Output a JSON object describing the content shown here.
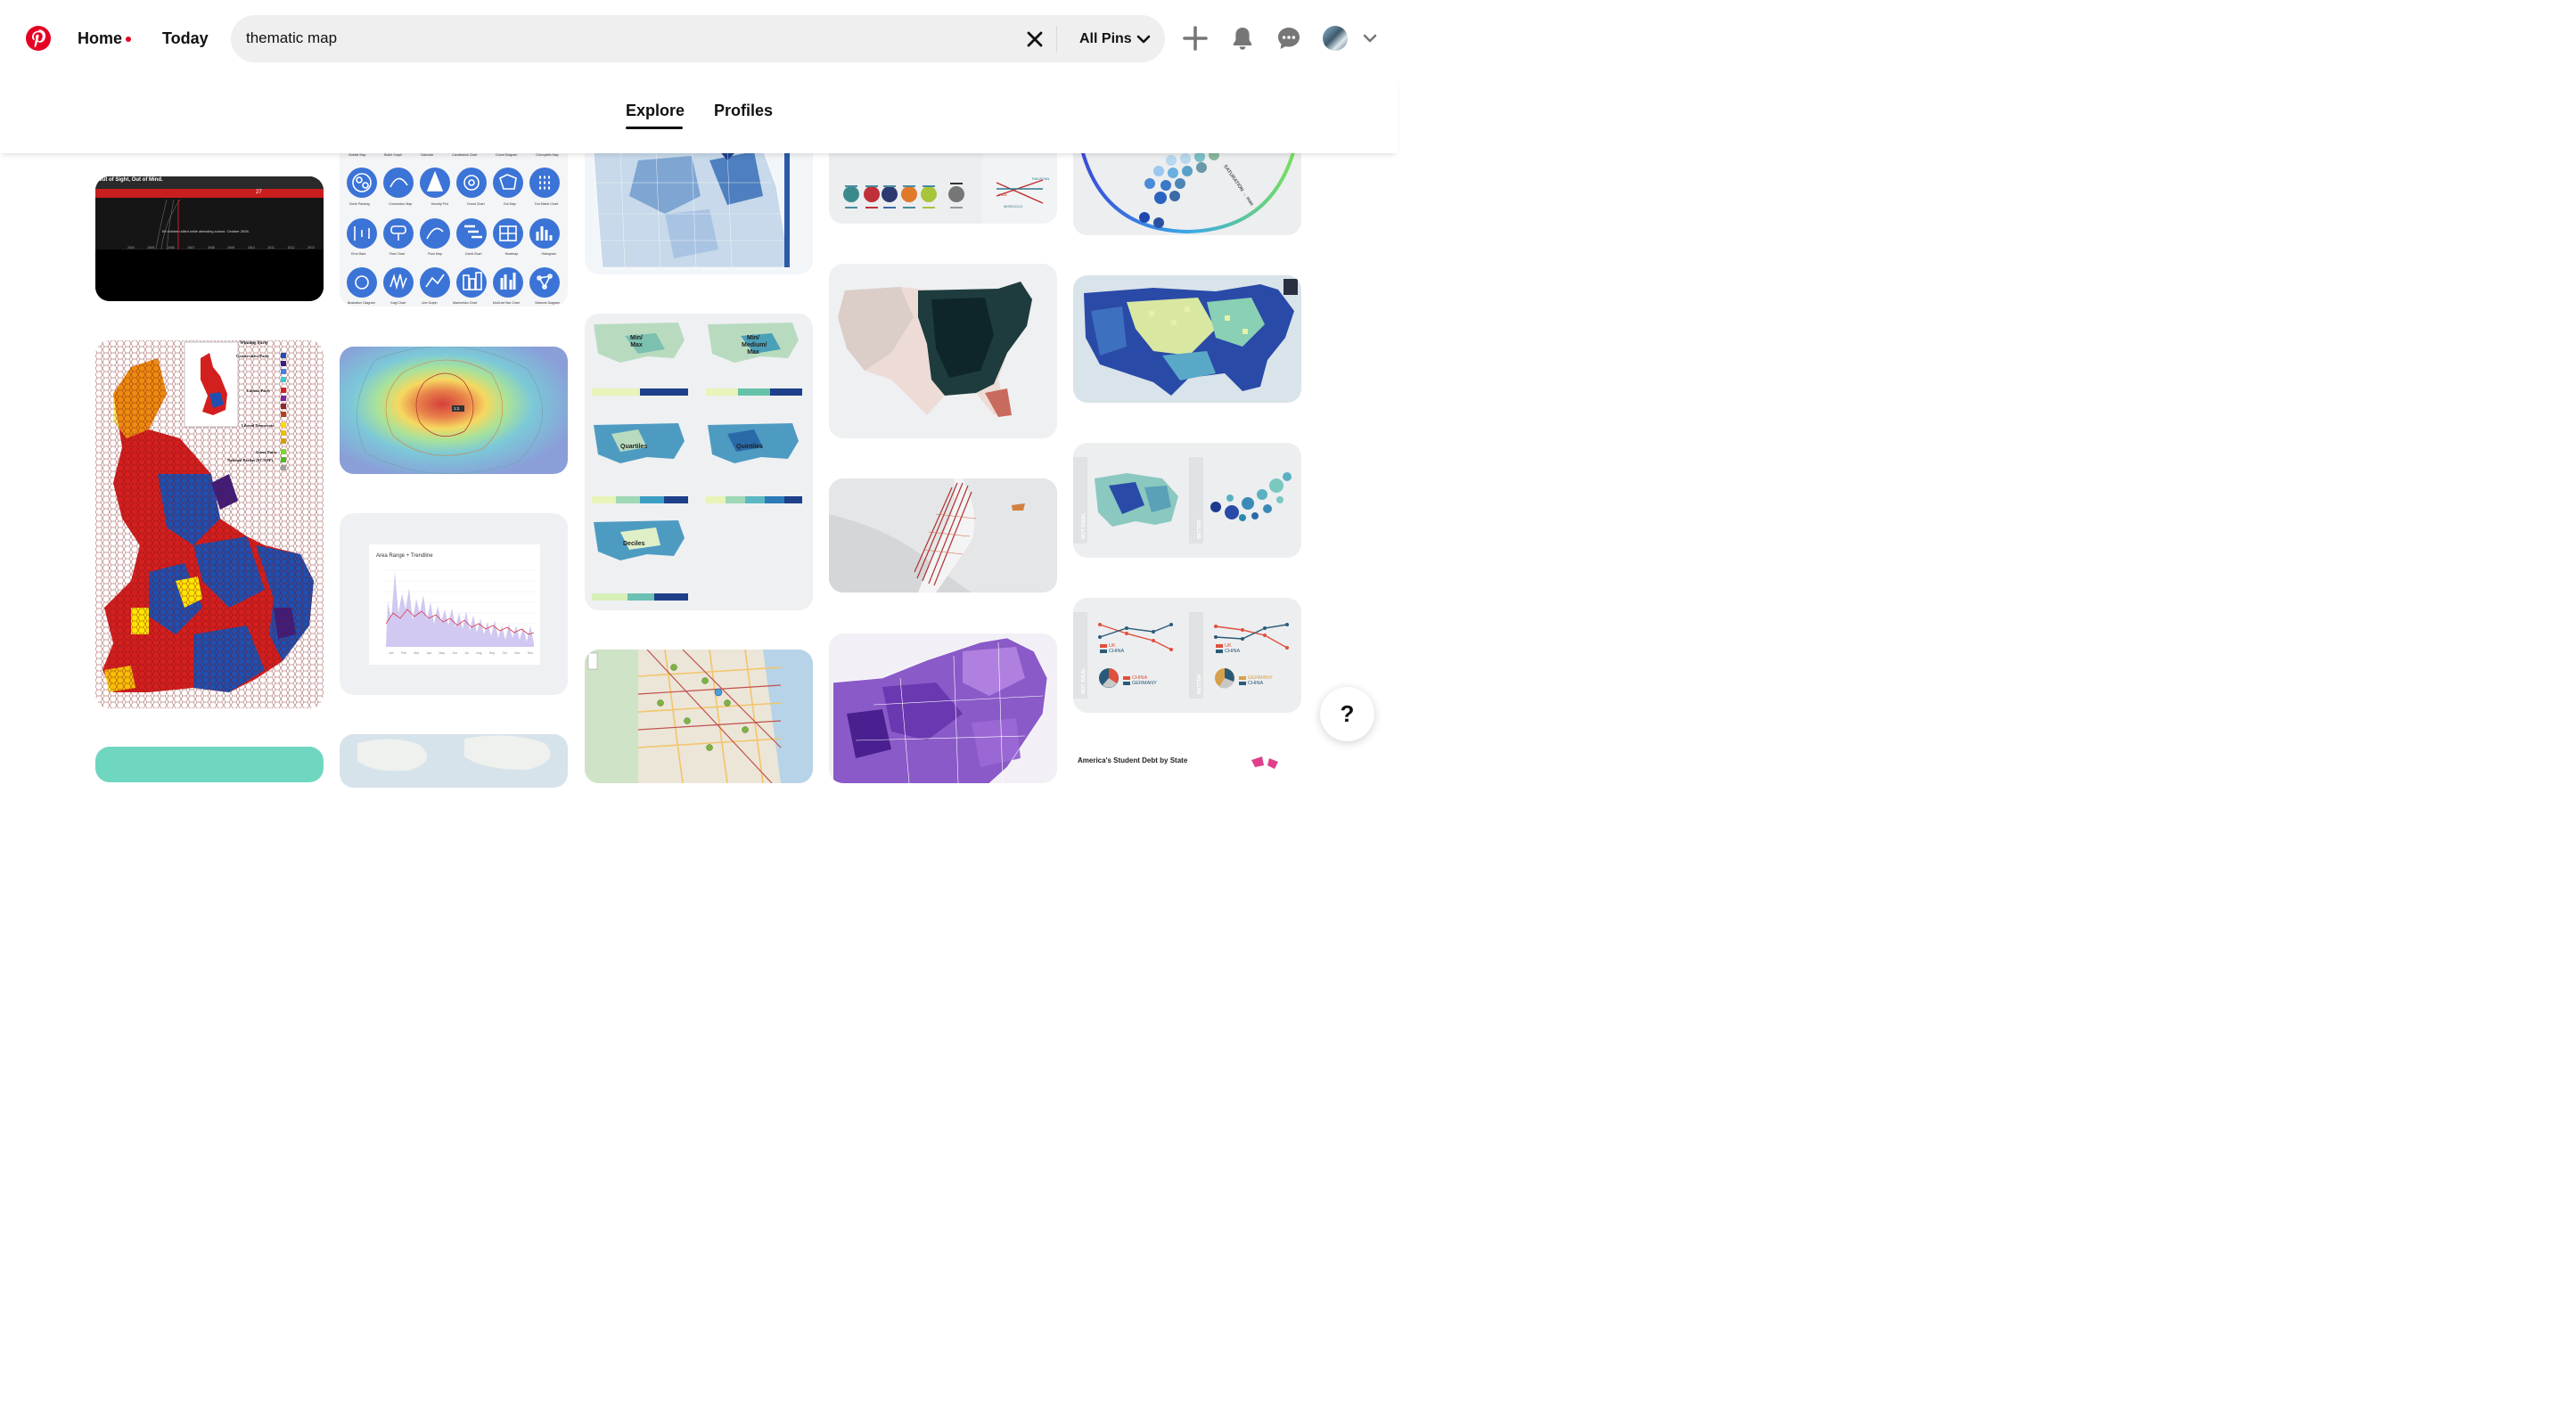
{
  "header": {
    "nav": {
      "home_label": "Home",
      "today_label": "Today"
    },
    "search": {
      "value": "thematic map",
      "scope_label": "All Pins"
    }
  },
  "tabs": {
    "explore_label": "Explore",
    "profiles_label": "Profiles",
    "active": "Explore"
  },
  "help": {
    "label": "?"
  },
  "colors": {
    "brand": "#e60023",
    "search_bg": "#efefef",
    "text": "#111111"
  },
  "icons": [
    "pinterest-logo-icon",
    "close-icon",
    "chevron-down-icon",
    "plus-icon",
    "bell-icon",
    "chat-icon",
    "avatar"
  ],
  "pins": {
    "school_shootings": {
      "title": "Out of Sight, Out of Mind.",
      "caption": "69 children killed while attending school. October 2006.",
      "count_label": "27",
      "years": [
        "2004",
        "2005",
        "2006",
        "2007",
        "2008",
        "2009",
        "2010",
        "2011",
        "2012",
        "2013"
      ]
    },
    "chart_catalogue": {
      "top_row": [
        "Bubble Map",
        "Bullet Graph",
        "Calendar",
        "Candlestick Chart",
        "Chord Diagram",
        "Choropleth Map"
      ],
      "rows": [
        [
          "Circle Packing",
          "Connection Map",
          "Density Plot",
          "Donut Chart",
          "Dot Map",
          "Dot Matrix Chart"
        ],
        [
          "Error Bars",
          "Flow Chart",
          "Flow Map",
          "Gantt Chart",
          "Heatmap",
          "Histogram"
        ],
        [
          "Illustration Diagram",
          "Kagi Chart",
          "Line Graph",
          "Marimekko Chart",
          "Multi-set Bar Chart",
          "Network Diagram"
        ]
      ]
    },
    "uk_hexmap": {
      "legend_title": "Winning Party",
      "legend_parties": [
        "Conservative Party",
        "Labour Party",
        "Liberal Democrats",
        "Green Party",
        "National Parties (PC/SNP)"
      ]
    },
    "heat_contour": {
      "marker_label": "1:2"
    },
    "area_range": {
      "title": "Area Range + Trendline",
      "months": [
        "Jan",
        "Feb",
        "Mar",
        "Apr",
        "May",
        "Jun",
        "Jul",
        "Aug",
        "Sep",
        "Oct",
        "Nov",
        "Dec"
      ]
    },
    "classification_maps": {
      "labels": [
        "Min/ Max",
        "Min/ Medium/ Max",
        "Quartiles",
        "Quintiles",
        "Deciles"
      ]
    },
    "not_ideal_better": {
      "left_label": "NOT IDEAL",
      "right_label": "BETTER"
    },
    "slope_compare": {
      "left_label": "NOT IDEAL",
      "right_label": "BETTER",
      "legend_left": [
        "UK",
        "CHINA"
      ],
      "legend_right": [
        "UK",
        "CHINA"
      ],
      "pie_left": [
        "CHINA",
        "GERMANY"
      ],
      "pie_right": [
        "GERMANY",
        "CHINA"
      ]
    },
    "student_debt": {
      "title": "America's Student Debt by State"
    },
    "color_legend": {
      "labels": [
        "PAKISTAN",
        "IRAN",
        "MOROCCO"
      ]
    },
    "saturation_wheel": {
      "label": "SATURATION → max"
    }
  }
}
